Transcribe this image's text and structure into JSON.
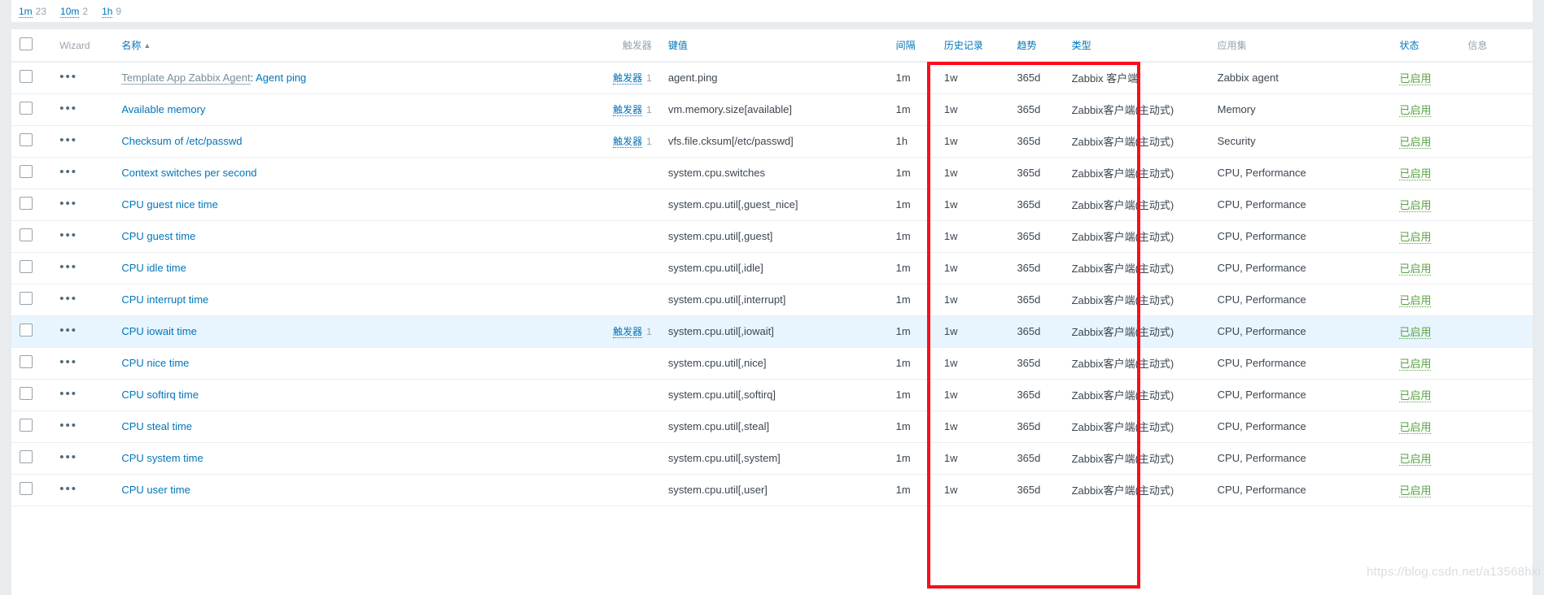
{
  "subfilter": {
    "groups": [
      {
        "label": "1m",
        "count": "23"
      },
      {
        "label": "10m",
        "count": "2"
      },
      {
        "label": "1h",
        "count": "9"
      }
    ]
  },
  "table": {
    "headers": {
      "wizard": "Wizard",
      "name": "名称",
      "sort_arrow": "▲",
      "triggers": "触发器",
      "key": "键值",
      "interval": "间隔",
      "history": "历史记录",
      "trends": "趋势",
      "type": "类型",
      "applications": "应用集",
      "status": "状态",
      "info": "信息"
    },
    "wizard_glyph": "•••",
    "rows": [
      {
        "template_prefix": "Template App Zabbix Agent",
        "name": "Agent ping",
        "trigger_label": "触发器",
        "trigger_count": "1",
        "key": "agent.ping",
        "interval": "1m",
        "history": "1w",
        "trends": "365d",
        "type": "Zabbix 客户端",
        "applications": "Zabbix agent",
        "status": "已启用",
        "info": "",
        "hovered": false
      },
      {
        "template_prefix": "",
        "name": "Available memory",
        "trigger_label": "触发器",
        "trigger_count": "1",
        "key": "vm.memory.size[available]",
        "interval": "1m",
        "history": "1w",
        "trends": "365d",
        "type": "Zabbix客户端(主动式)",
        "applications": "Memory",
        "status": "已启用",
        "info": "",
        "hovered": false
      },
      {
        "template_prefix": "",
        "name": "Checksum of /etc/passwd",
        "trigger_label": "触发器",
        "trigger_count": "1",
        "key": "vfs.file.cksum[/etc/passwd]",
        "interval": "1h",
        "history": "1w",
        "trends": "365d",
        "type": "Zabbix客户端(主动式)",
        "applications": "Security",
        "status": "已启用",
        "info": "",
        "hovered": false
      },
      {
        "template_prefix": "",
        "name": "Context switches per second",
        "trigger_label": "",
        "trigger_count": "",
        "key": "system.cpu.switches",
        "interval": "1m",
        "history": "1w",
        "trends": "365d",
        "type": "Zabbix客户端(主动式)",
        "applications": "CPU, Performance",
        "status": "已启用",
        "info": "",
        "hovered": false
      },
      {
        "template_prefix": "",
        "name": "CPU guest nice time",
        "trigger_label": "",
        "trigger_count": "",
        "key": "system.cpu.util[,guest_nice]",
        "interval": "1m",
        "history": "1w",
        "trends": "365d",
        "type": "Zabbix客户端(主动式)",
        "applications": "CPU, Performance",
        "status": "已启用",
        "info": "",
        "hovered": false
      },
      {
        "template_prefix": "",
        "name": "CPU guest time",
        "trigger_label": "",
        "trigger_count": "",
        "key": "system.cpu.util[,guest]",
        "interval": "1m",
        "history": "1w",
        "trends": "365d",
        "type": "Zabbix客户端(主动式)",
        "applications": "CPU, Performance",
        "status": "已启用",
        "info": "",
        "hovered": false
      },
      {
        "template_prefix": "",
        "name": "CPU idle time",
        "trigger_label": "",
        "trigger_count": "",
        "key": "system.cpu.util[,idle]",
        "interval": "1m",
        "history": "1w",
        "trends": "365d",
        "type": "Zabbix客户端(主动式)",
        "applications": "CPU, Performance",
        "status": "已启用",
        "info": "",
        "hovered": false
      },
      {
        "template_prefix": "",
        "name": "CPU interrupt time",
        "trigger_label": "",
        "trigger_count": "",
        "key": "system.cpu.util[,interrupt]",
        "interval": "1m",
        "history": "1w",
        "trends": "365d",
        "type": "Zabbix客户端(主动式)",
        "applications": "CPU, Performance",
        "status": "已启用",
        "info": "",
        "hovered": false
      },
      {
        "template_prefix": "",
        "name": "CPU iowait time",
        "trigger_label": "触发器",
        "trigger_count": "1",
        "key": "system.cpu.util[,iowait]",
        "interval": "1m",
        "history": "1w",
        "trends": "365d",
        "type": "Zabbix客户端(主动式)",
        "applications": "CPU, Performance",
        "status": "已启用",
        "info": "",
        "hovered": true
      },
      {
        "template_prefix": "",
        "name": "CPU nice time",
        "trigger_label": "",
        "trigger_count": "",
        "key": "system.cpu.util[,nice]",
        "interval": "1m",
        "history": "1w",
        "trends": "365d",
        "type": "Zabbix客户端(主动式)",
        "applications": "CPU, Performance",
        "status": "已启用",
        "info": "",
        "hovered": false
      },
      {
        "template_prefix": "",
        "name": "CPU softirq time",
        "trigger_label": "",
        "trigger_count": "",
        "key": "system.cpu.util[,softirq]",
        "interval": "1m",
        "history": "1w",
        "trends": "365d",
        "type": "Zabbix客户端(主动式)",
        "applications": "CPU, Performance",
        "status": "已启用",
        "info": "",
        "hovered": false
      },
      {
        "template_prefix": "",
        "name": "CPU steal time",
        "trigger_label": "",
        "trigger_count": "",
        "key": "system.cpu.util[,steal]",
        "interval": "1m",
        "history": "1w",
        "trends": "365d",
        "type": "Zabbix客户端(主动式)",
        "applications": "CPU, Performance",
        "status": "已启用",
        "info": "",
        "hovered": false
      },
      {
        "template_prefix": "",
        "name": "CPU system time",
        "trigger_label": "",
        "trigger_count": "",
        "key": "system.cpu.util[,system]",
        "interval": "1m",
        "history": "1w",
        "trends": "365d",
        "type": "Zabbix客户端(主动式)",
        "applications": "CPU, Performance",
        "status": "已启用",
        "info": "",
        "hovered": false
      },
      {
        "template_prefix": "",
        "name": "CPU user time",
        "trigger_label": "",
        "trigger_count": "",
        "key": "system.cpu.util[,user]",
        "interval": "1m",
        "history": "1w",
        "trends": "365d",
        "type": "Zabbix客户端(主动式)",
        "applications": "CPU, Performance",
        "status": "已启用",
        "info": "",
        "hovered": false
      }
    ]
  },
  "annotation": {
    "color": "#fc0d1b"
  },
  "watermark": {
    "text": "https://blog.csdn.net/a13568hki"
  }
}
